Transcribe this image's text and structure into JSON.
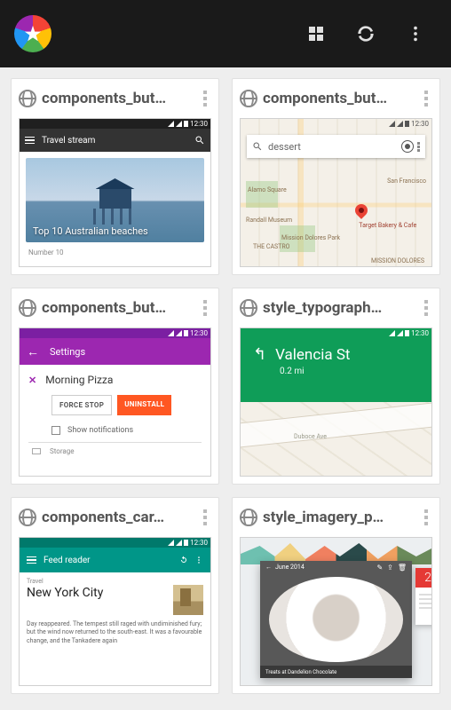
{
  "toolbar": {
    "logo_name": "multicolor-star-logo"
  },
  "cards": [
    {
      "title": "components_but…",
      "thumb": {
        "statusbar_time": "12:30",
        "appbar_title": "Travel stream",
        "photo_caption": "Top 10 Australian beaches",
        "below_text": "Number 10"
      }
    },
    {
      "title": "components_but…",
      "thumb": {
        "statusbar_time": "12:30",
        "search_value": "dessert",
        "pin_label": "Target Bakery & Cafe",
        "poi": [
          "Alamo Square",
          "San Francisco",
          "Randall Museum",
          "THE CASTRO",
          "MISSION DOLORES",
          "Mission Dolores Park"
        ]
      }
    },
    {
      "title": "components_but…",
      "thumb": {
        "statusbar_time": "12:30",
        "appbar_title": "Settings",
        "app_name": "Morning Pizza",
        "btn_force": "FORCE STOP",
        "btn_uninstall": "UNINSTALL",
        "checkbox_label": "Show notifications",
        "storage_label": "Storage"
      }
    },
    {
      "title": "style_typograph…",
      "thumb": {
        "statusbar_time": "12:30",
        "street": "Valencia St",
        "distance": "0.2 mi",
        "road_label": "Duboce Ave"
      }
    },
    {
      "title": "components_car…",
      "thumb": {
        "statusbar_time": "12:30",
        "appbar_title": "Feed reader",
        "category": "Travel",
        "headline": "New York City",
        "body": "Day reappeared. The tempest still raged with undiminished fury; but the wind now returned to the south-east. It was a favourable change, and the Tankadere again"
      }
    },
    {
      "title": "style_imagery_p…",
      "thumb": {
        "month_label": "June 2014",
        "day_number": "2",
        "caption": "Treats at Dandelion Chocolate"
      }
    }
  ]
}
